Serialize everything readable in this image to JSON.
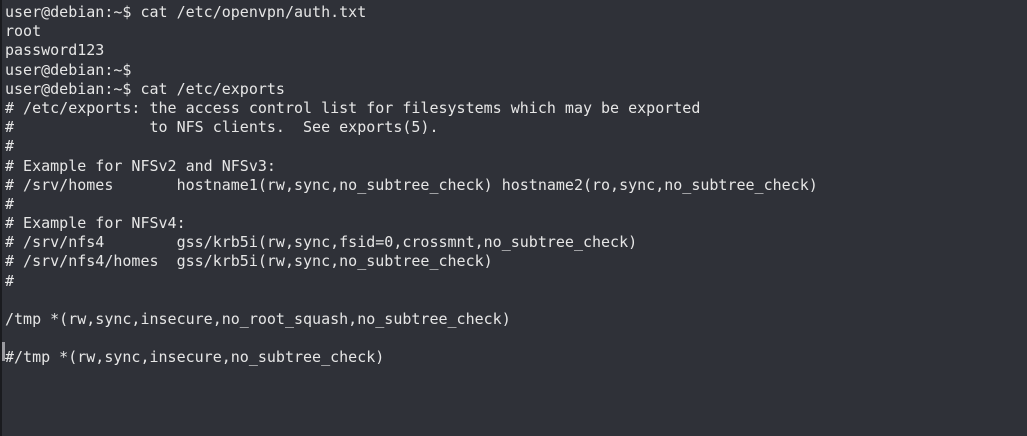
{
  "terminal": {
    "lines": [
      "user@debian:~$ cat /etc/openvpn/auth.txt",
      "root",
      "password123",
      "user@debian:~$",
      "user@debian:~$ cat /etc/exports",
      "# /etc/exports: the access control list for filesystems which may be exported",
      "#               to NFS clients.  See exports(5).",
      "#",
      "# Example for NFSv2 and NFSv3:",
      "# /srv/homes       hostname1(rw,sync,no_subtree_check) hostname2(ro,sync,no_subtree_check)",
      "#",
      "# Example for NFSv4:",
      "# /srv/nfs4        gss/krb5i(rw,sync,fsid=0,crossmnt,no_subtree_check)",
      "# /srv/nfs4/homes  gss/krb5i(rw,sync,no_subtree_check)",
      "#",
      "",
      "/tmp *(rw,sync,insecure,no_root_squash,no_subtree_check)",
      "",
      "#/tmp *(rw,sync,insecure,no_subtree_check)"
    ]
  }
}
